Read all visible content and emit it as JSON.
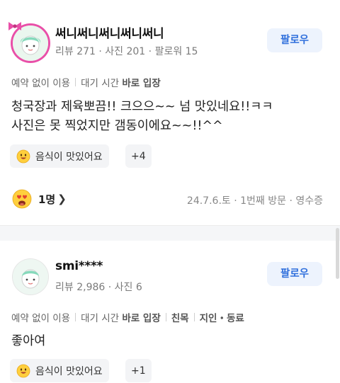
{
  "reviews": [
    {
      "author": "써니써니써니써니써니",
      "stats": "리뷰 271 · 사진 201 · 팔로워 15",
      "follow_label": "팔로우",
      "tags": [
        {
          "plain": "예약 없이 이용"
        },
        {
          "plain": "대기 시간 ",
          "bold": "바로 입장"
        }
      ],
      "text_lines": [
        "청국장과 제육뽀끔!! 크으으~~ 넘 맛있네요!!ㅋㅋ",
        "사진은 못 찍었지만 갬동이에요~~!!^^"
      ],
      "chip_label": "음식이 맛있어요",
      "chip_more": "+4",
      "likes": "1명",
      "visit_meta": "24.7.6.토 · 1번째 방문 · 영수증"
    },
    {
      "author": "smi****",
      "stats": "리뷰 2,986 · 사진 6",
      "follow_label": "팔로우",
      "tags": [
        {
          "plain": "예약 없이 이용"
        },
        {
          "plain": "대기 시간 ",
          "bold": "바로 입장"
        },
        {
          "bold": "친목"
        },
        {
          "bold": "지인・동료"
        }
      ],
      "text_lines": [
        "좋아여"
      ],
      "chip_label": "음식이 맛있어요",
      "chip_more": "+1"
    }
  ],
  "icons": {
    "avatar": "avatar-icon",
    "bow": "ribbon-icon",
    "chip_emoji": "smiley-face-icon",
    "like_emoji": "heart-eyes-face-icon",
    "chevron": "chevron-right-icon"
  },
  "colors": {
    "follow_text": "#2f6fdc",
    "follow_bg": "#edf3fd",
    "avatar_ring": "#e94fa8"
  }
}
